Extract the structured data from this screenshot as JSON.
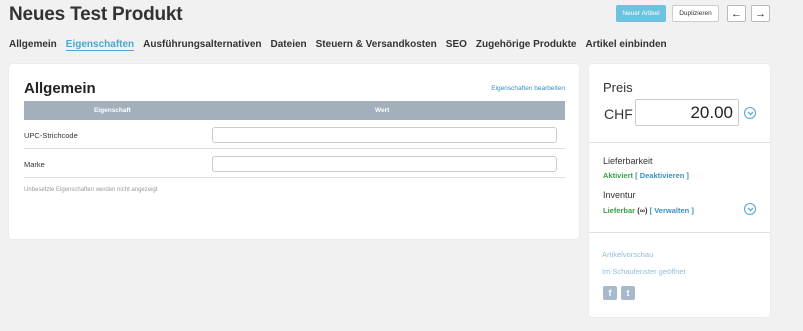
{
  "header": {
    "title": "Neues Test Produkt",
    "new_article_label": "Neuer Artikel",
    "duplicate_label": "Duplizieren",
    "prev_icon": "←",
    "next_icon": "→"
  },
  "tabs": [
    {
      "label": "Allgemein",
      "active": false
    },
    {
      "label": "Eigenschaften",
      "active": true
    },
    {
      "label": "Ausführungsalternativen",
      "active": false
    },
    {
      "label": "Dateien",
      "active": false
    },
    {
      "label": "Steuern & Versandkosten",
      "active": false
    },
    {
      "label": "SEO",
      "active": false
    },
    {
      "label": "Zugehörige Produkte",
      "active": false
    },
    {
      "label": "Artikel einbinden",
      "active": false
    }
  ],
  "main": {
    "title": "Allgemein",
    "edit_link": "Eigenschaften bearbeiten",
    "columns": [
      "Eigenschaft",
      "Wert"
    ],
    "rows": [
      {
        "label": "UPC-Strichcode",
        "value": ""
      },
      {
        "label": "Marke",
        "value": ""
      }
    ],
    "hint": "Unbesetzte Eigenschaften werden nicht angezeigt"
  },
  "side": {
    "price_label": "Preis",
    "currency": "CHF",
    "price_value": "20.00",
    "availability_label": "Lieferbarkeit",
    "availability_active": "Aktiviert",
    "availability_deactivate": "[ Deaktivieren ]",
    "inventory_label": "Inventur",
    "inventory_status": "Lieferbar",
    "inventory_infinity": "(∞)",
    "inventory_manage": "[ Verwalten ]",
    "preview_link": "Artikelvorschau",
    "storefront_link": "Im Schaufenster geöffnet",
    "facebook_icon": "f",
    "twitter_icon": "t"
  },
  "colors": {
    "accent": "#4aa7d0",
    "primary_button": "#6cc3df",
    "table_header": "#a3afbb",
    "green_status": "#3aa04a"
  }
}
